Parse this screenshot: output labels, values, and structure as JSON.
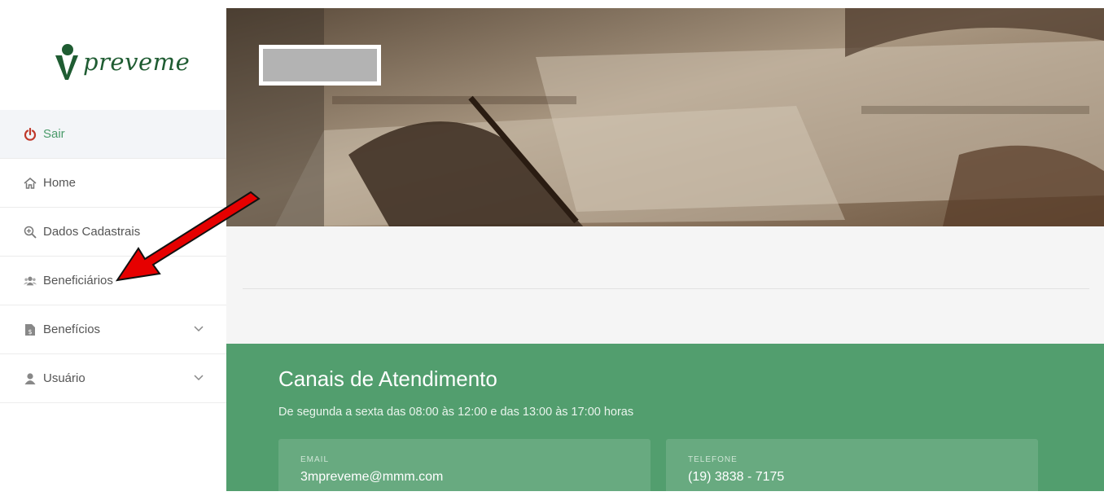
{
  "brand": {
    "logo_text": "preveme",
    "logo_color": "#1f5c32"
  },
  "sidebar": {
    "items": [
      {
        "label": "Sair",
        "icon": "power-icon",
        "active": true,
        "color": "#c0392b"
      },
      {
        "label": "Home",
        "icon": "home-icon"
      },
      {
        "label": "Dados Cadastrais",
        "icon": "zoom-in-icon"
      },
      {
        "label": "Beneficiários",
        "icon": "users-icon"
      },
      {
        "label": "Benefícios",
        "icon": "document-icon",
        "expandable": true
      },
      {
        "label": "Usuário",
        "icon": "user-icon",
        "expandable": true
      }
    ]
  },
  "canais": {
    "title": "Canais de Atendimento",
    "subtitle": "De segunda a sexta das 08:00 às 12:00 e das 13:00 às 17:00 horas",
    "email": {
      "label": "EMAIL",
      "value": "3mpreveme@mmm.com"
    },
    "telefone": {
      "label": "TELEFONE",
      "value": "(19) 3838 - 7175"
    }
  },
  "colors": {
    "green": "#529e6e",
    "annotation_arrow": "#e60000"
  }
}
